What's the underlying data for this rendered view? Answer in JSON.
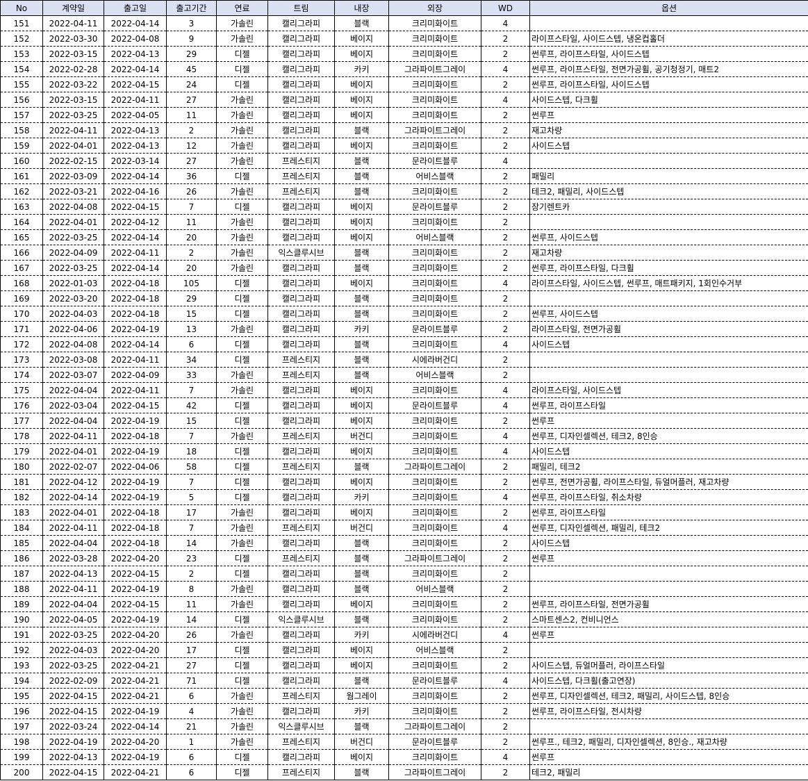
{
  "headers": [
    "No",
    "계약일",
    "출고일",
    "출고기간",
    "연료",
    "트림",
    "내장",
    "외장",
    "WD",
    "옵션"
  ],
  "rows": [
    [
      "151",
      "2022-04-11",
      "2022-04-14",
      "3",
      "가솔린",
      "캘리그라피",
      "블랙",
      "크리미화이트",
      "4",
      ""
    ],
    [
      "152",
      "2022-03-30",
      "2022-04-08",
      "9",
      "가솔린",
      "캘리그라피",
      "베이지",
      "크리미화이트",
      "2",
      "라이프스타일, 사이드스텝, 냉온컵홀더"
    ],
    [
      "153",
      "2022-03-15",
      "2022-04-13",
      "29",
      "디젤",
      "캘리그라피",
      "베이지",
      "크리미화이트",
      "2",
      "썬루프, 라이프스타일, 사이드스텝"
    ],
    [
      "154",
      "2022-02-28",
      "2022-04-14",
      "45",
      "디젤",
      "캘리그라피",
      "카키",
      "그라파이트그레이",
      "4",
      "썬루프, 라이프스타일, 전면가공휠, 공기청정기, 매트2"
    ],
    [
      "155",
      "2022-03-22",
      "2022-04-15",
      "24",
      "디젤",
      "캘리그라피",
      "베이지",
      "크리미화이트",
      "2",
      "썬루프, 라이프스타일, 사이드스텝"
    ],
    [
      "156",
      "2022-03-15",
      "2022-04-11",
      "27",
      "가솔린",
      "캘리그라피",
      "베이지",
      "크리미화이트",
      "4",
      "사이드스텝, 다크휠"
    ],
    [
      "157",
      "2022-03-25",
      "2022-04-05",
      "11",
      "가솔린",
      "캘리그라피",
      "베이지",
      "크리미화이트",
      "2",
      "썬루프"
    ],
    [
      "158",
      "2022-04-11",
      "2022-04-13",
      "2",
      "가솔린",
      "캘리그라피",
      "블랙",
      "그라파이트그레이",
      "2",
      "재고차량"
    ],
    [
      "159",
      "2022-04-01",
      "2022-04-13",
      "12",
      "가솔린",
      "캘리그라피",
      "베이지",
      "크리미화이트",
      "2",
      "사이드스텝"
    ],
    [
      "160",
      "2022-02-15",
      "2022-03-14",
      "27",
      "가솔린",
      "프레스티지",
      "블랙",
      "문라이트블루",
      "4",
      ""
    ],
    [
      "161",
      "2022-03-09",
      "2022-04-14",
      "36",
      "디젤",
      "프레스티지",
      "블랙",
      "어비스블랙",
      "2",
      "패밀리"
    ],
    [
      "162",
      "2022-03-21",
      "2022-04-16",
      "26",
      "가솔린",
      "프레스티지",
      "블랙",
      "크리미화이트",
      "2",
      "테크2, 패밀리, 사이드스텝"
    ],
    [
      "163",
      "2022-04-08",
      "2022-04-15",
      "7",
      "디젤",
      "캘리그라피",
      "베이지",
      "문라이트블루",
      "2",
      "장기렌트카"
    ],
    [
      "164",
      "2022-04-01",
      "2022-04-12",
      "11",
      "가솔린",
      "캘리그라피",
      "베이지",
      "크리미화이트",
      "2",
      ""
    ],
    [
      "165",
      "2022-03-25",
      "2022-04-14",
      "20",
      "가솔린",
      "캘리그라피",
      "베이지",
      "어비스블랙",
      "2",
      "썬루프, 사이드스텝"
    ],
    [
      "166",
      "2022-04-09",
      "2022-04-11",
      "2",
      "가솔린",
      "익스클루시브",
      "블랙",
      "크리미화이트",
      "2",
      "재고차량"
    ],
    [
      "167",
      "2022-03-25",
      "2022-04-14",
      "20",
      "가솔린",
      "캘리그라피",
      "블랙",
      "크리미화이트",
      "2",
      "썬루프, 라이프스타일, 다크휠"
    ],
    [
      "168",
      "2022-01-03",
      "2022-04-18",
      "105",
      "디젤",
      "캘리그라피",
      "베이지",
      "크리미화이트",
      "4",
      "라이프스타일, 사이드스텝, 썬루프, 매트패키지, 1회인수거부"
    ],
    [
      "169",
      "2022-03-20",
      "2022-04-18",
      "29",
      "디젤",
      "캘리그라피",
      "블랙",
      "크리미화이트",
      "2",
      ""
    ],
    [
      "170",
      "2022-04-03",
      "2022-04-18",
      "15",
      "디젤",
      "캘리그라피",
      "블랙",
      "크리미화이트",
      "2",
      "썬루프, 사이드스텝"
    ],
    [
      "171",
      "2022-04-06",
      "2022-04-19",
      "13",
      "가솔린",
      "캘리그라피",
      "카키",
      "문라이트블루",
      "2",
      "라이프스타일, 전면가공휠"
    ],
    [
      "172",
      "2022-04-08",
      "2022-04-14",
      "6",
      "디젤",
      "캘리그라피",
      "블랙",
      "크리미화이트",
      "4",
      "사이드스텝"
    ],
    [
      "173",
      "2022-03-08",
      "2022-04-11",
      "34",
      "디젤",
      "프레스티지",
      "블랙",
      "시에라버건디",
      "2",
      ""
    ],
    [
      "174",
      "2022-03-07",
      "2022-04-09",
      "33",
      "가솔린",
      "프레스티지",
      "블랙",
      "어비스블랙",
      "2",
      ""
    ],
    [
      "175",
      "2022-04-04",
      "2022-04-11",
      "7",
      "가솔린",
      "캘리그라피",
      "베이지",
      "크리미화이트",
      "4",
      "라이프스타일, 사이드스텝"
    ],
    [
      "176",
      "2022-03-04",
      "2022-04-15",
      "42",
      "디젤",
      "캘리그라피",
      "베이지",
      "문라이트블루",
      "4",
      "썬루프, 라이프스타일"
    ],
    [
      "177",
      "2022-04-04",
      "2022-04-19",
      "15",
      "디젤",
      "캘리그라피",
      "베이지",
      "크리미화이트",
      "2",
      "썬루프"
    ],
    [
      "178",
      "2022-04-11",
      "2022-04-18",
      "7",
      "가솔린",
      "프레스티지",
      "버건디",
      "크리미화이트",
      "4",
      "썬루프, 디자인셀렉션, 테크2, 8인승"
    ],
    [
      "179",
      "2022-04-01",
      "2022-04-19",
      "18",
      "디젤",
      "캘리그라피",
      "베이지",
      "크리미화이트",
      "4",
      "사이드스텝"
    ],
    [
      "180",
      "2022-02-07",
      "2022-04-06",
      "58",
      "디젤",
      "프레스티지",
      "블랙",
      "그라파이트그레이",
      "2",
      "패밀리, 테크2"
    ],
    [
      "181",
      "2022-04-12",
      "2022-04-19",
      "7",
      "디젤",
      "캘리그라피",
      "베이지",
      "크리미화이트",
      "2",
      "썬루프, 전면가공휠, 라이프스타일, 듀얼머플러, 재고차량"
    ],
    [
      "182",
      "2022-04-14",
      "2022-04-19",
      "5",
      "디젤",
      "캘리그라피",
      "카키",
      "크리미화이트",
      "4",
      "썬루프, 라이프스타일, 취소차량"
    ],
    [
      "183",
      "2022-04-01",
      "2022-04-18",
      "17",
      "가솔린",
      "캘리그라피",
      "베이지",
      "크리미화이트",
      "2",
      "썬루프, 라이프스타일"
    ],
    [
      "184",
      "2022-04-11",
      "2022-04-18",
      "7",
      "가솔린",
      "프레스티지",
      "버건디",
      "크리미화이트",
      "4",
      "썬루프, 디자인셀렉션, 패밀리, 테크2"
    ],
    [
      "185",
      "2022-04-04",
      "2022-04-18",
      "14",
      "가솔린",
      "캘리그라피",
      "블랙",
      "크리미화이트",
      "2",
      "사이드스텝"
    ],
    [
      "186",
      "2022-03-28",
      "2022-04-20",
      "23",
      "디젤",
      "프레스티지",
      "블랙",
      "그라파이트그레이",
      "2",
      "썬루프"
    ],
    [
      "187",
      "2022-04-13",
      "2022-04-15",
      "2",
      "디젤",
      "캘리그라피",
      "블랙",
      "크리미화이트",
      "2",
      ""
    ],
    [
      "188",
      "2022-04-11",
      "2022-04-19",
      "8",
      "가솔린",
      "캘리그라피",
      "블랙",
      "어비스블랙",
      "2",
      ""
    ],
    [
      "189",
      "2022-04-04",
      "2022-04-15",
      "11",
      "가솔린",
      "캘리그라피",
      "베이지",
      "크리미화이트",
      "2",
      "썬루프, 라이프스타일, 전면가공휠"
    ],
    [
      "190",
      "2022-04-05",
      "2022-04-19",
      "14",
      "디젤",
      "익스클루시브",
      "블랙",
      "크리미화이트",
      "2",
      "스마트센스2, 컨비니언스"
    ],
    [
      "191",
      "2022-03-25",
      "2022-04-20",
      "26",
      "가솔린",
      "캘리그라피",
      "카키",
      "시에라버건디",
      "4",
      "썬루프"
    ],
    [
      "192",
      "2022-04-03",
      "2022-04-20",
      "17",
      "디젤",
      "캘리그라피",
      "베이지",
      "어비스블랙",
      "2",
      ""
    ],
    [
      "193",
      "2022-03-25",
      "2022-04-21",
      "27",
      "디젤",
      "캘리그라피",
      "베이지",
      "크리미화이트",
      "2",
      "사이드스텝, 듀얼머플러, 라이프스타일"
    ],
    [
      "194",
      "2022-02-09",
      "2022-04-21",
      "71",
      "디젤",
      "캘리그라피",
      "블랙",
      "문라이트블루",
      "4",
      "사이드스텝, 다크휠(출고연장)"
    ],
    [
      "195",
      "2022-04-15",
      "2022-04-21",
      "6",
      "가솔린",
      "프레스티지",
      "웜그레이",
      "크리미화이트",
      "2",
      "썬루프, 디자인셀렉션, 테크2, 패밀리, 사이드스텝, 8인승"
    ],
    [
      "196",
      "2022-04-15",
      "2022-04-19",
      "4",
      "가솔린",
      "캘리그라피",
      "카키",
      "크리미화이트",
      "2",
      "썬루프, 라이프스타일, 전시차량"
    ],
    [
      "197",
      "2022-03-24",
      "2022-04-14",
      "21",
      "가솔린",
      "익스클루시브",
      "블랙",
      "그라파이트그레이",
      "2",
      ""
    ],
    [
      "198",
      "2022-04-19",
      "2022-04-20",
      "1",
      "가솔린",
      "프레스티지",
      "버건디",
      "문라이트블루",
      "2",
      "썬루프., 테크2, 패밀리, 디자인셀렉션, 8인승., 재고차량"
    ],
    [
      "199",
      "2022-04-13",
      "2022-04-19",
      "6",
      "디젤",
      "캘리그라피",
      "베이지",
      "크리미화이트",
      "4",
      "썬루프"
    ],
    [
      "200",
      "2022-04-15",
      "2022-04-21",
      "6",
      "디젤",
      "프레스티지",
      "블랙",
      "그라파이트그레이",
      "2",
      "테크2, 패밀리"
    ]
  ]
}
